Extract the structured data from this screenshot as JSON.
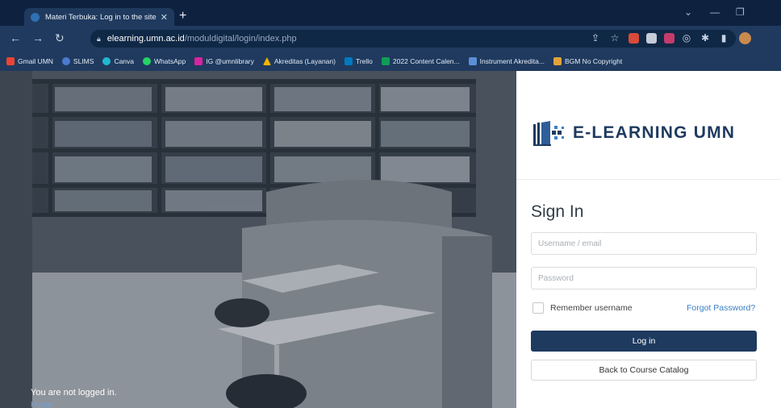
{
  "browser": {
    "tab": {
      "title": "Materi Terbuka: Log in to the site"
    },
    "address": {
      "domain": "elearning.umn.ac.id",
      "path": "/moduldigital/login/index.php"
    },
    "bookmarks": [
      {
        "label": "Gmail UMN",
        "icon": "gmail-icon",
        "color": "#ea4335"
      },
      {
        "label": "SLIMS",
        "icon": "slims-icon",
        "color": "#4a7bd0"
      },
      {
        "label": "Canva",
        "icon": "canva-icon",
        "color": "#22b7d3"
      },
      {
        "label": "WhatsApp",
        "icon": "whatsapp-icon",
        "color": "#25d366"
      },
      {
        "label": "IG @umnlibrary",
        "icon": "instagram-icon",
        "color": "#d6249f"
      },
      {
        "label": "Akreditas (Layanan)",
        "icon": "google-drive-icon",
        "color": "#f4b400"
      },
      {
        "label": "Trello",
        "icon": "trello-icon",
        "color": "#0079bf"
      },
      {
        "label": "2022 Content Calen...",
        "icon": "google-sheets-icon",
        "color": "#0f9d58"
      },
      {
        "label": "Instrument Akredita...",
        "icon": "google-forms-icon",
        "color": "#5b8fd6"
      },
      {
        "label": "BGM No Copyright",
        "icon": "youtube-music-icon",
        "color": "#e3a23a"
      }
    ]
  },
  "page": {
    "not_logged_in": "You are not logged in.",
    "home_link": "Home"
  },
  "login": {
    "logo_text": "E-LEARNING UMN",
    "heading": "Sign In",
    "username_placeholder": "Username / email",
    "password_placeholder": "Password",
    "remember_label": "Remember username",
    "forgot_label": "Forgot Password?",
    "login_button": "Log in",
    "back_button": "Back to Course Catalog"
  },
  "colors": {
    "brand": "#1e3a5f",
    "link": "#3c7fc4",
    "chrome": "#1f3a5e"
  }
}
